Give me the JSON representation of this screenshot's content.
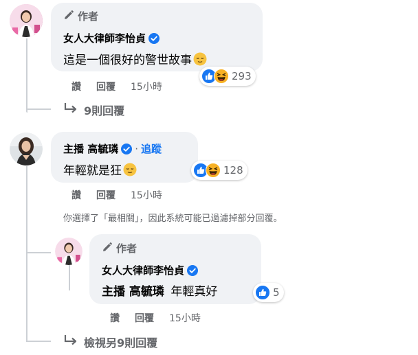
{
  "comments": [
    {
      "author_tag": "作者",
      "name": "女人大律師李怡貞",
      "text": "這是一個很好的警世故事",
      "reaction_count": "293",
      "reply_label": "讚",
      "reply2_label": "回覆",
      "time": "15小時",
      "replies_link": "9則回覆"
    },
    {
      "name": "主播 高毓璘",
      "follow_label": "追蹤",
      "separator": "·",
      "text": "年輕就是狂",
      "reaction_count": "128",
      "reply_label": "讚",
      "reply2_label": "回覆",
      "time": "15小時"
    }
  ],
  "filter_notice": "你選擇了「最相關」，因此系統可能已過濾掉部分回覆。",
  "reply": {
    "author_tag": "作者",
    "name": "女人大律師李怡貞",
    "mention": "主播 高毓璘",
    "text": "年輕真好",
    "reaction_count": "5",
    "like_label": "讚",
    "reply_label": "回覆",
    "time": "15小時"
  },
  "more_replies_link": "檢視另9則回覆",
  "colors": {
    "like_blue": "#1877f2",
    "haha_yellow": "#f7b125",
    "muted": "#65676b"
  }
}
